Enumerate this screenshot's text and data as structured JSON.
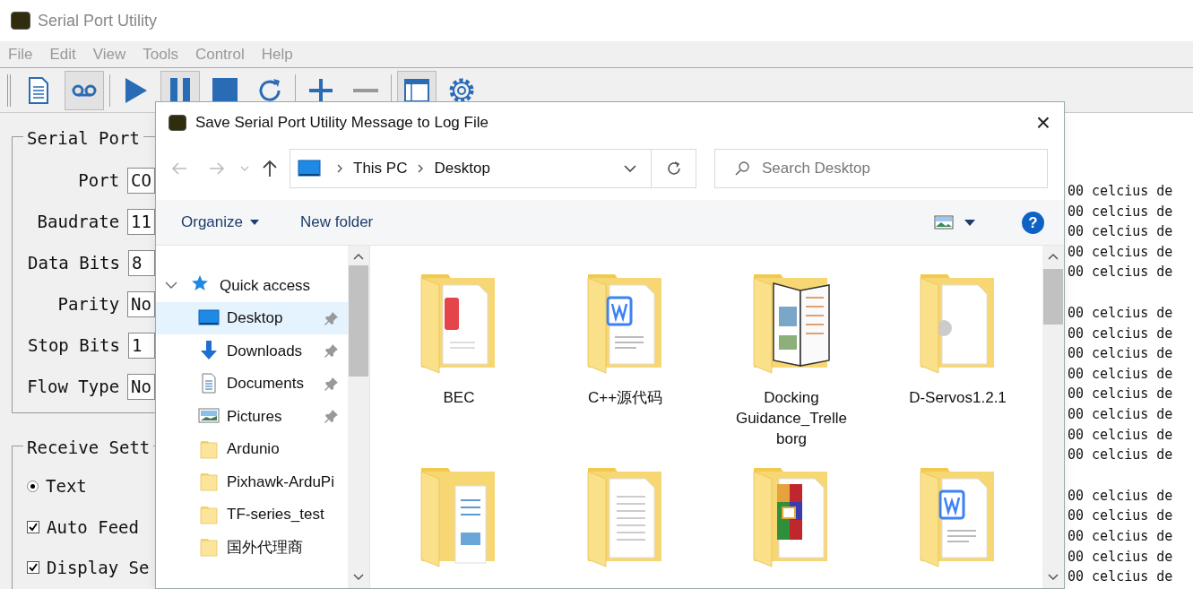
{
  "window": {
    "title": "Serial Port Utility"
  },
  "menu": [
    "File",
    "Edit",
    "View",
    "Tools",
    "Control",
    "Help"
  ],
  "toolbar": [
    {
      "kind": "document",
      "pressed": false
    },
    {
      "kind": "tape",
      "pressed": true
    },
    {
      "kind": "play",
      "pressed": false
    },
    {
      "kind": "pause",
      "pressed": true
    },
    {
      "kind": "stop",
      "pressed": false
    },
    {
      "kind": "refresh",
      "pressed": false
    },
    {
      "kind": "plus",
      "pressed": false
    },
    {
      "kind": "minus",
      "pressed": false
    },
    {
      "kind": "window",
      "pressed": true
    },
    {
      "kind": "gear",
      "pressed": false
    }
  ],
  "serial_port": {
    "title": "Serial Port",
    "fields": [
      {
        "label": "Port",
        "value": "CO"
      },
      {
        "label": "Baudrate",
        "value": "11"
      },
      {
        "label": "Data Bits",
        "value": "8"
      },
      {
        "label": "Parity",
        "value": "No"
      },
      {
        "label": "Stop Bits",
        "value": "1"
      },
      {
        "label": "Flow Type",
        "value": "No"
      }
    ]
  },
  "receive_settings": {
    "title": "Receive Sett",
    "options": [
      {
        "kind": "radio",
        "label": "Text",
        "checked": true
      },
      {
        "kind": "checkbox",
        "label": "Auto Feed",
        "checked": true
      },
      {
        "kind": "checkbox",
        "label": "Display Se",
        "checked": true
      }
    ]
  },
  "log_groups": [
    [
      "00 celcius de",
      "00 celcius de",
      "00 celcius de",
      "00 celcius de",
      "00 celcius de"
    ],
    [
      "00 celcius de",
      "00 celcius de",
      "00 celcius de",
      "00 celcius de",
      "00 celcius de",
      "00 celcius de",
      "00 celcius de",
      "00 celcius de"
    ],
    [
      "00 celcius de",
      "00 celcius de",
      "00 celcius de",
      "00 celcius de",
      "00 celcius de"
    ]
  ],
  "dialog": {
    "title": "Save Serial Port Utility Message to Log File",
    "close": "×",
    "breadcrumb": [
      "This PC",
      "Desktop"
    ],
    "search": {
      "placeholder": "Search Desktop"
    },
    "commands": [
      "Organize",
      "New folder"
    ],
    "help": "?",
    "nav": [
      {
        "label": "Quick access",
        "expanded": true,
        "children": [
          {
            "label": "Desktop",
            "pinned": true,
            "selected": true
          },
          {
            "label": "Downloads",
            "pinned": true,
            "selected": false
          },
          {
            "label": "Documents",
            "pinned": true,
            "selected": false
          },
          {
            "label": "Pictures",
            "pinned": true,
            "selected": false
          },
          {
            "label": "Ardunio",
            "pinned": false,
            "selected": false
          },
          {
            "label": "Pixhawk-ArduPi",
            "pinned": false,
            "selected": false
          },
          {
            "label": "TF-series_test",
            "pinned": false,
            "selected": false
          },
          {
            "label": "国外代理商",
            "pinned": false,
            "selected": false
          }
        ]
      }
    ],
    "folders": [
      {
        "name": "BEC",
        "kind": "pdf"
      },
      {
        "name": "C++源代码",
        "kind": "word"
      },
      {
        "name": "Docking Guidance_Trelleborg",
        "kind": "booklet"
      },
      {
        "name": "D-Servos1.2.1",
        "kind": "gear"
      },
      {
        "kind": "picture"
      },
      {
        "kind": "lines"
      },
      {
        "kind": "archive"
      },
      {
        "kind": "word"
      }
    ]
  }
}
